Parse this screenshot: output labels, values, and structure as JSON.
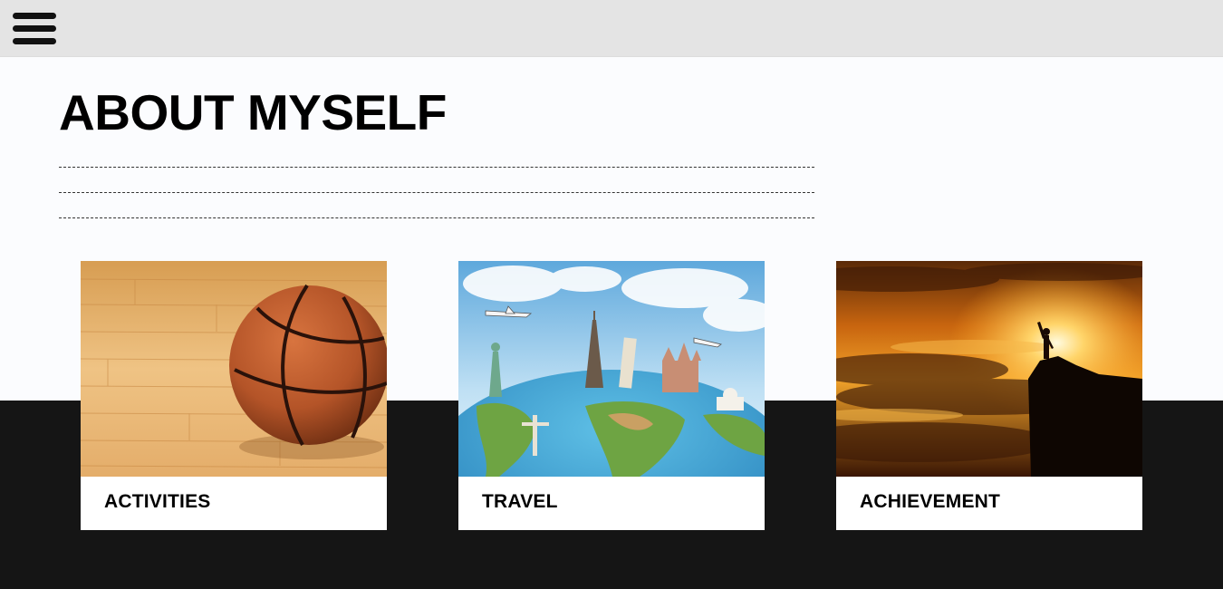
{
  "topbar": {
    "menu_icon": "hamburger-menu-icon"
  },
  "main": {
    "title": "ABOUT MYSELF"
  },
  "cards": [
    {
      "label": "ACTIVITIES",
      "image": "basketball-on-wood-floor"
    },
    {
      "label": "TRAVEL",
      "image": "world-landmarks-globe"
    },
    {
      "label": "ACHIEVEMENT",
      "image": "person-on-cliff-at-sunset"
    }
  ],
  "colors": {
    "topbar_bg": "#e4e4e4",
    "page_bg": "#fbfcfe",
    "dark_band": "#151515",
    "text": "#000000"
  }
}
